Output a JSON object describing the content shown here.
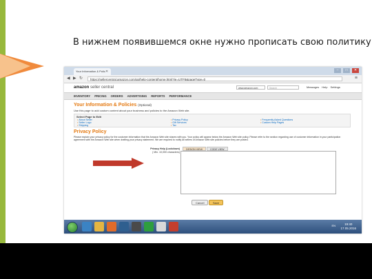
{
  "slide": {
    "title": "В нижнем появившемся окне нужно прописать свою политику!",
    "accent_color": "#97b83c",
    "chevron_color": "#f08a3c",
    "arrow_color": "#c0392b"
  },
  "browser": {
    "tab_title": "Your Information & Polic",
    "url": "https://sellercentral.amazon.com/gp/help-content/home.html?ie=UTF8&pageType=0",
    "back_icon": "back-arrow-icon",
    "forward_icon": "forward-arrow-icon",
    "reload_icon": "reload-icon",
    "menu_icon": "menu-icon"
  },
  "seller_central": {
    "logo_brand": "amazon",
    "logo_product": "seller central",
    "marketplace": "www.amazon.com",
    "search_placeholder": "Search",
    "header_links": [
      "Messages",
      "Help",
      "Settings"
    ],
    "nav": [
      "INVENTORY",
      "PRICING",
      "ORDERS",
      "ADVERTISING",
      "REPORTS",
      "PERFORMANCE"
    ]
  },
  "page": {
    "title": "Your Information & Policies",
    "title_optional": "(Optional)",
    "subtitle": "Use this page to add custom content about your business and policies to the Amazon Web site.",
    "select_box_title": "Select Page to Edit",
    "links_col1": [
      "About Seller",
      "Seller Logo",
      "Shipping"
    ],
    "links_col2": [
      "Privacy Policy",
      "Gift Services",
      "Tax"
    ],
    "links_col3": [
      "Frequently Asked Questions",
      "Custom Help Pages"
    ],
    "section_title": "Privacy Policy",
    "section_desc": "Please explain your privacy policy for the customer information that the Amazon Web site shares with you. Your policy will appear below the Amazon Web site policy. Please refer to the section regarding use of customer information in your participation agreement with the Amazon Web site when drafting your privacy statement. We are required to notify all sellers of Amazon Web site policies before they are posted.",
    "editor_label": "Privacy Help (Lockdown)",
    "editor_sublabel": "( Min. 10,000 characters)",
    "editor_tab_design": "DESIGN VIEW",
    "editor_tab_code": "CODE VIEW",
    "cancel_label": "Cancel",
    "save_label": "Save"
  },
  "taskbar": {
    "tray_lang": "EN",
    "time": "19:40",
    "date": "17.05.2016"
  }
}
